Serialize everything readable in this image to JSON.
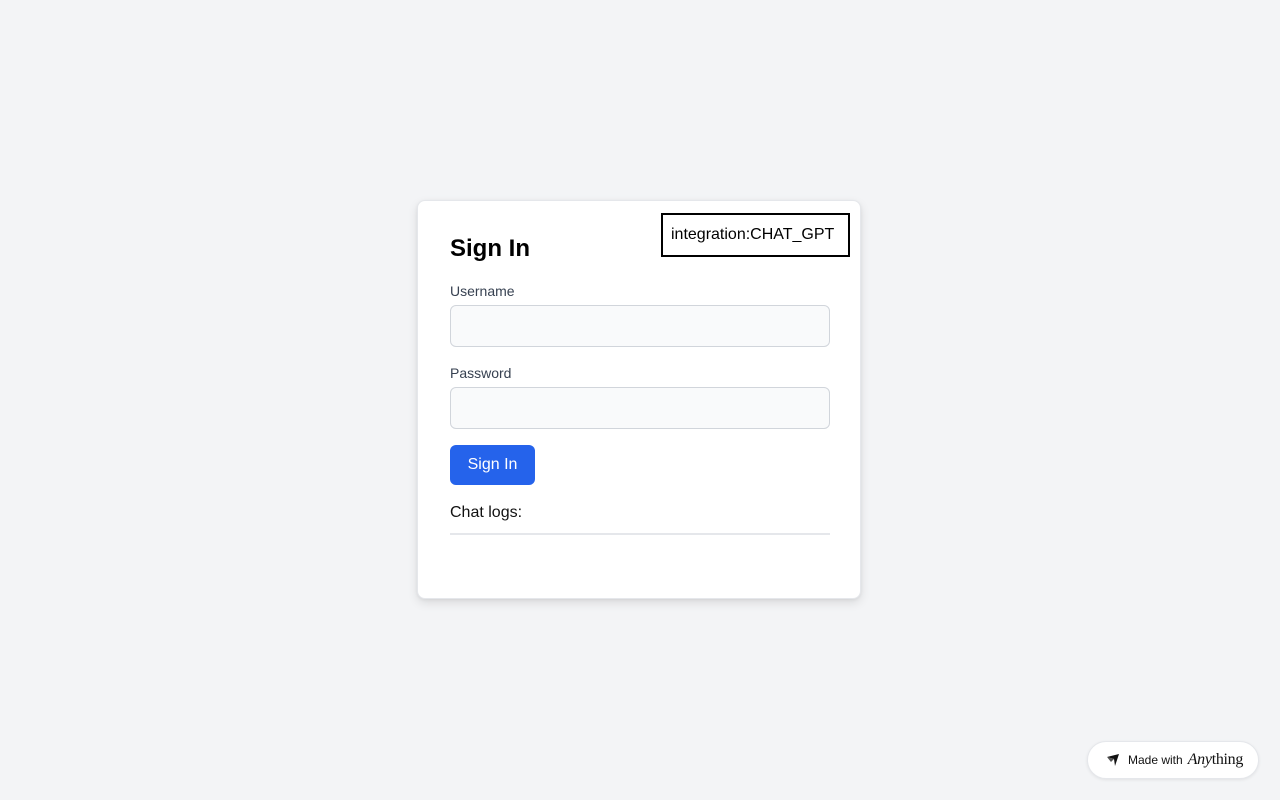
{
  "integration_badge": "integration:CHAT_GPT",
  "form": {
    "title": "Sign In",
    "username_label": "Username",
    "username_value": "",
    "username_placeholder": "",
    "password_label": "Password",
    "password_value": "",
    "password_placeholder": "",
    "submit_label": "Sign In"
  },
  "chat_logs": {
    "title": "Chat logs:",
    "entries": []
  },
  "footer_badge": {
    "prefix": "Made with",
    "brand_italic": "Any",
    "brand_rest": "thing",
    "icon": "anything-logo-icon"
  },
  "colors": {
    "accent": "#2563eb",
    "background": "#f3f4f6"
  }
}
